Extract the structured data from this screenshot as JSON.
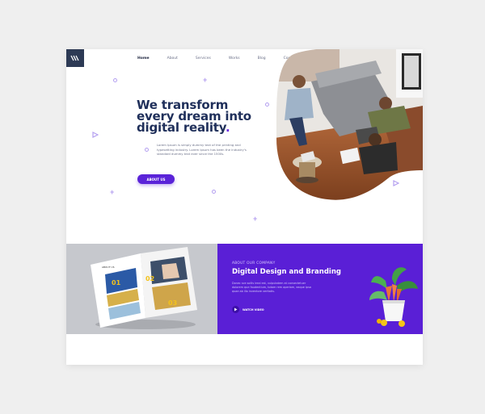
{
  "nav": {
    "items": [
      {
        "label": "Home",
        "active": true
      },
      {
        "label": "About",
        "active": false
      },
      {
        "label": "Services",
        "active": false
      },
      {
        "label": "Works",
        "active": false
      },
      {
        "label": "Blog",
        "active": false
      },
      {
        "label": "Contact",
        "active": false
      }
    ]
  },
  "hero": {
    "title_line1": "We transform",
    "title_line2": "every dream into",
    "title_line3": "digital reality",
    "title_dot": ".",
    "text": "Lorem Ipsum is simply dummy text of the printing and typesetting industry. Lorem Ipsum has been the industry's standard dummy text ever since the 1500s.",
    "button_label": "ABOUT US"
  },
  "company": {
    "eyebrow": "ABOUT OUR COMPANY",
    "title": "Digital Design and Branding",
    "text": "Donec sce sollis ireal est, vulputatem at consectetuer dolorem que faudentium, totam rem aperiam, eaque ipsa quae ab illo inventore veritatis.",
    "watch_label": "WATCH VIDEO"
  },
  "brochure": {
    "page_numbers": [
      "01",
      "02",
      "03"
    ],
    "header_text": "ABOUT US"
  },
  "colors": {
    "accent": "#5a1fd6",
    "navy": "#1f2f5a",
    "shape": "#b49ff0"
  },
  "icons": {
    "logo": "stripes-logo-icon",
    "play": "play-icon"
  }
}
